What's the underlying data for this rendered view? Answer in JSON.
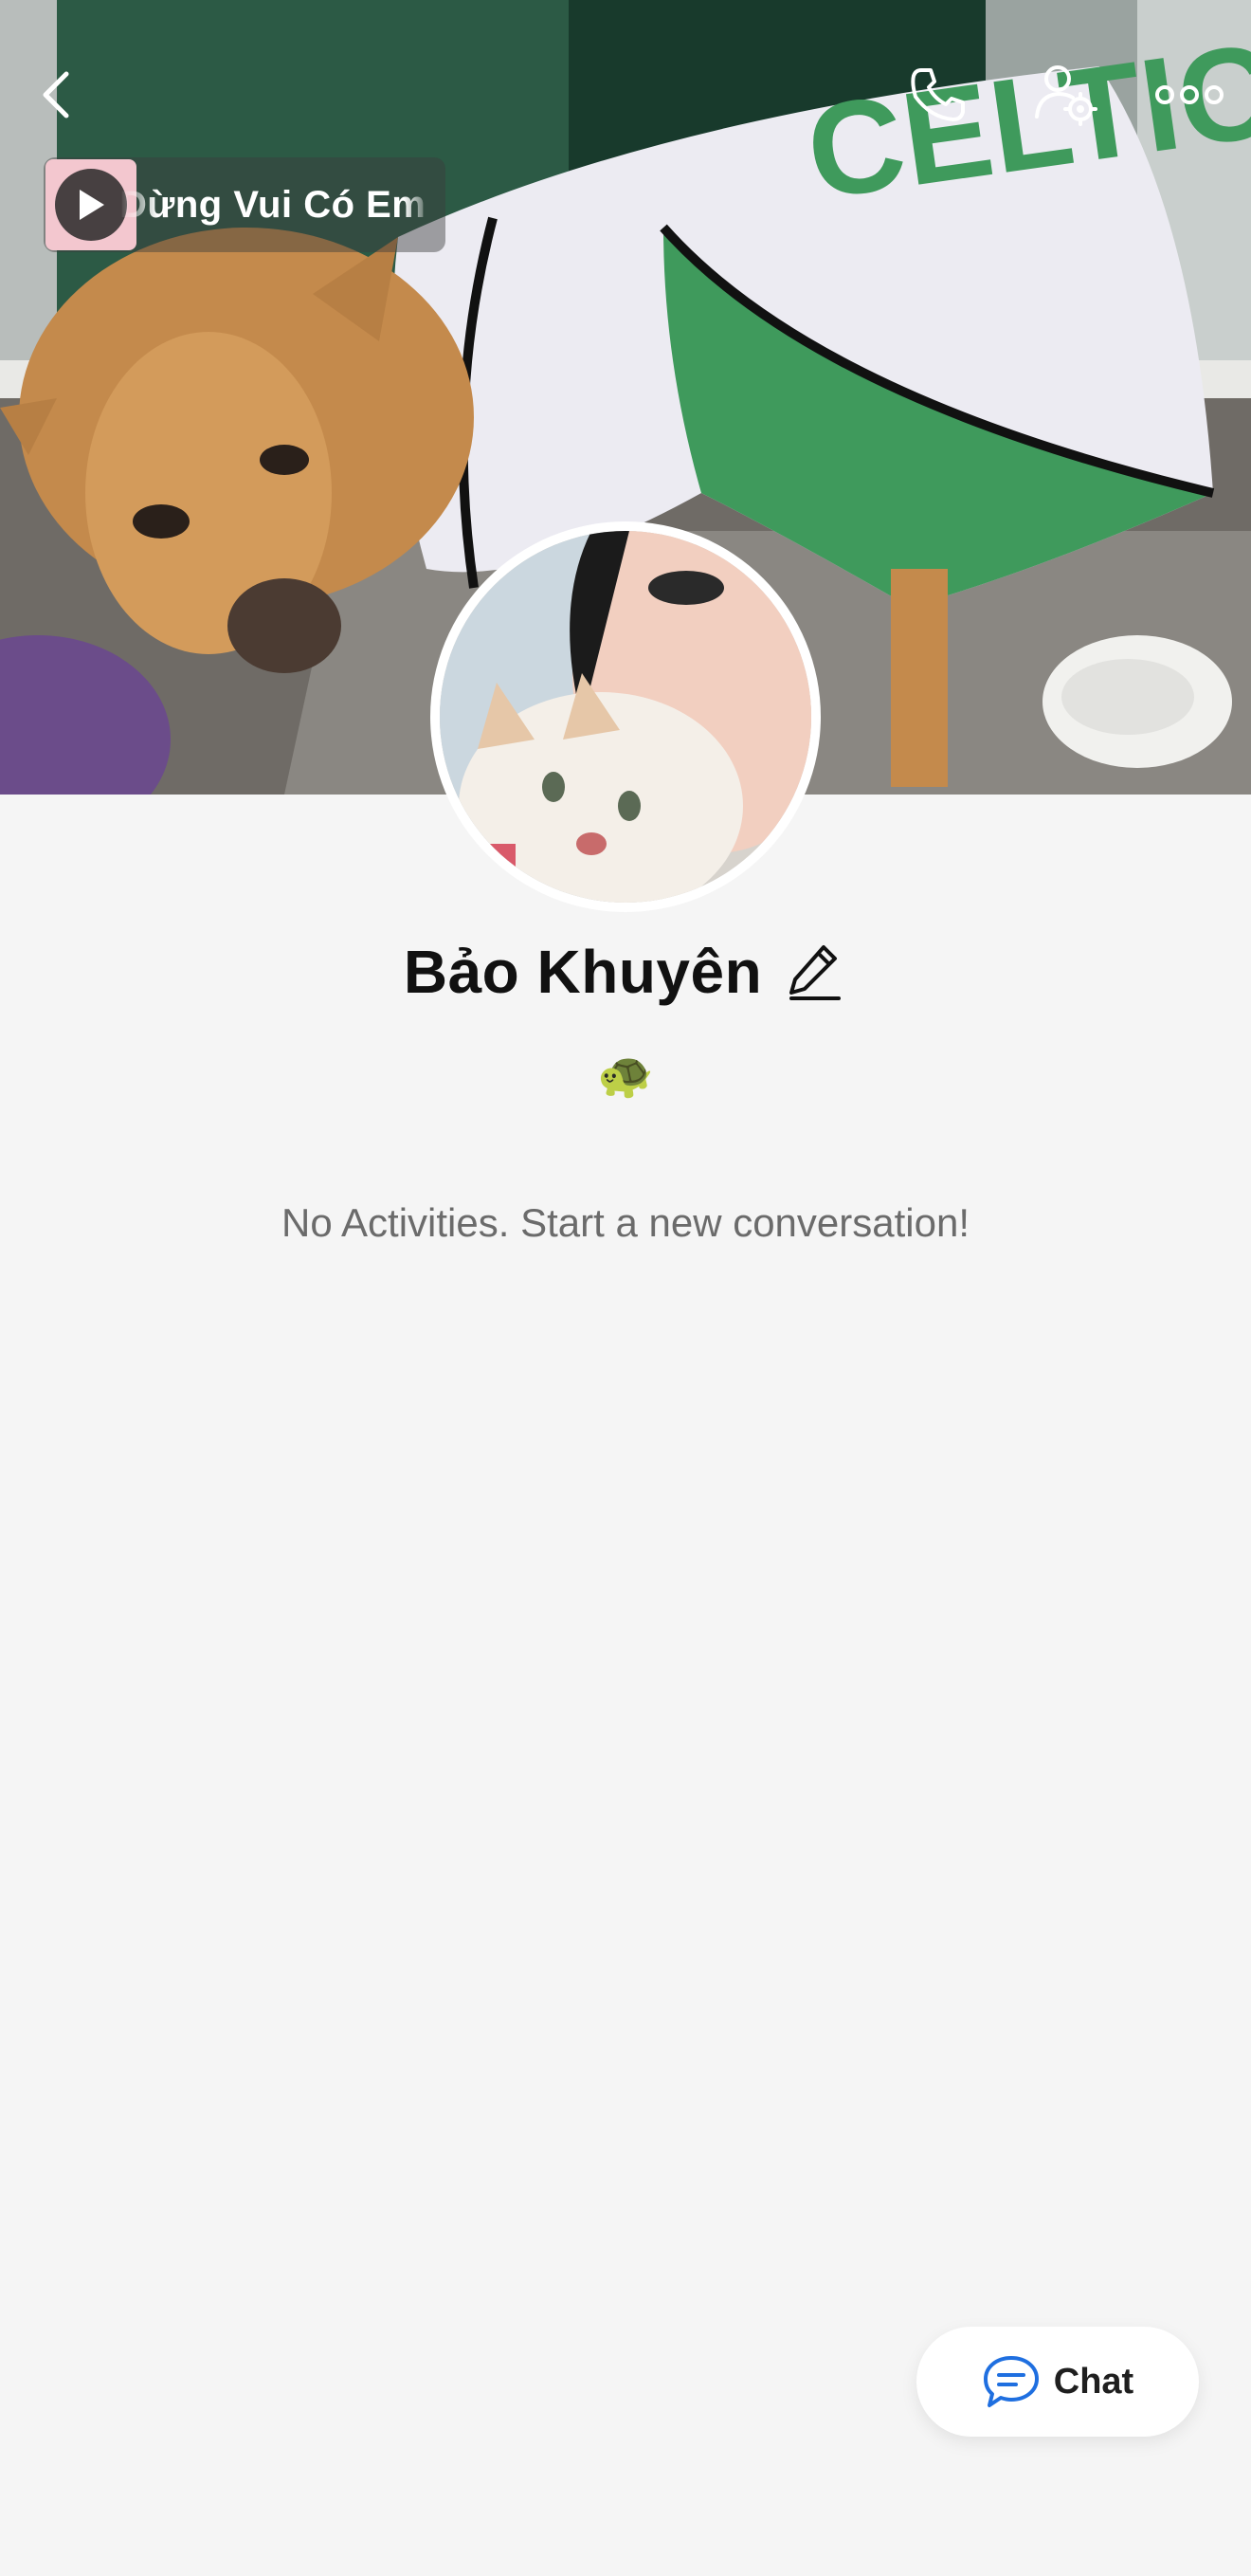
{
  "header": {
    "back_icon": "chevron-left-icon",
    "phone_icon": "phone-icon",
    "friend_settings_icon": "user-gear-icon",
    "more_icon": "more-horizontal-icon"
  },
  "music": {
    "play_icon": "play-icon",
    "title": "Dừng Vui          Có Em"
  },
  "profile": {
    "name": "Bảo Khuyên",
    "edit_icon": "pencil-icon",
    "status_emoji": "🐢"
  },
  "activity": {
    "empty_text": "No Activities. Start a new conversation!"
  },
  "chat_button": {
    "label": "Chat",
    "icon": "chat-bubble-icon",
    "accent": "#1f6fe0"
  },
  "colors": {
    "background": "#f5f5f5",
    "text_primary": "#111111",
    "text_secondary": "#6b6b6b",
    "accent": "#1f6fe0"
  }
}
